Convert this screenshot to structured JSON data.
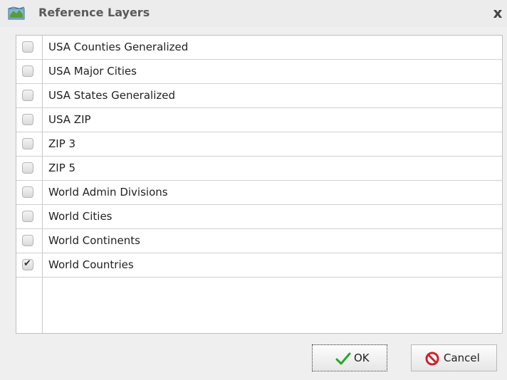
{
  "dialog": {
    "title": "Reference Layers",
    "close_label": "x"
  },
  "layers": [
    {
      "label": "USA Counties Generalized",
      "checked": false
    },
    {
      "label": "USA Major Cities",
      "checked": false
    },
    {
      "label": "USA States Generalized",
      "checked": false
    },
    {
      "label": "USA ZIP",
      "checked": false
    },
    {
      "label": "ZIP 3",
      "checked": false
    },
    {
      "label": "ZIP 5",
      "checked": false
    },
    {
      "label": "World Admin Divisions",
      "checked": false
    },
    {
      "label": "World Cities",
      "checked": false
    },
    {
      "label": "World Continents",
      "checked": false
    },
    {
      "label": "World Countries",
      "checked": true
    }
  ],
  "buttons": {
    "ok_label": "OK",
    "cancel_label": "Cancel"
  },
  "icons": {
    "title": "map-layers-icon",
    "ok": "green-checkmark-icon",
    "cancel": "red-prohibited-icon"
  }
}
